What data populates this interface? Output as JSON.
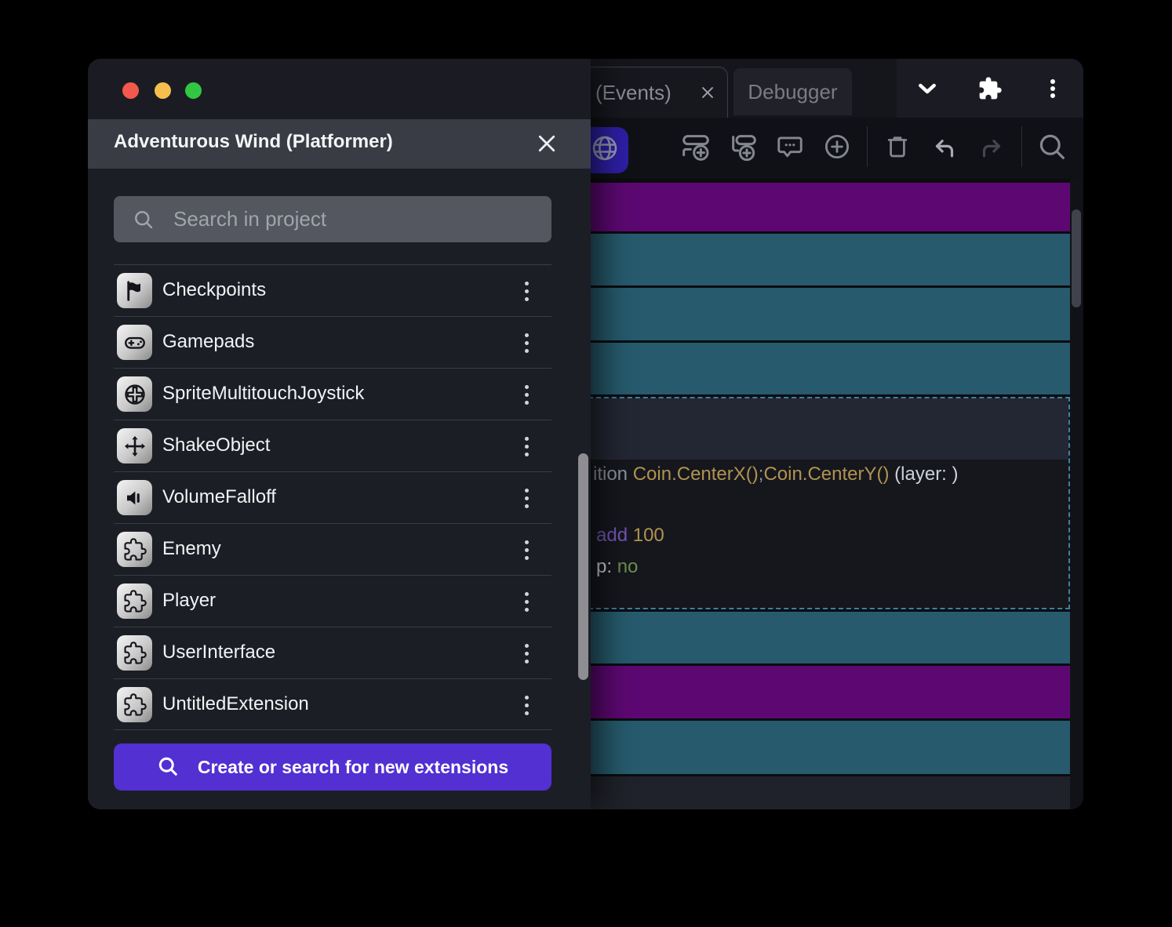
{
  "project_panel": {
    "title": "Adventurous Wind (Platformer)",
    "search_placeholder": "Search in project",
    "items": [
      {
        "label": "Checkpoints",
        "icon": "flag"
      },
      {
        "label": "Gamepads",
        "icon": "gamepad"
      },
      {
        "label": "SpriteMultitouchJoystick",
        "icon": "joystick"
      },
      {
        "label": "ShakeObject",
        "icon": "move"
      },
      {
        "label": "VolumeFalloff",
        "icon": "volume"
      },
      {
        "label": "Enemy",
        "icon": "puzzle"
      },
      {
        "label": "Player",
        "icon": "puzzle"
      },
      {
        "label": "UserInterface",
        "icon": "puzzle"
      },
      {
        "label": "UntitledExtension",
        "icon": "puzzle"
      }
    ],
    "cta_label": "Create or search for new extensions"
  },
  "editor": {
    "tabs": [
      {
        "label": "(Events)",
        "active": true,
        "closable": true
      },
      {
        "label": "Debugger",
        "active": false
      }
    ],
    "window_icons": [
      "chevron-down",
      "puzzle-filled",
      "kebab"
    ],
    "toolbar": [
      {
        "icon": "add-event"
      },
      {
        "icon": "add-subevent"
      },
      {
        "icon": "comment"
      },
      {
        "icon": "add-circle"
      },
      {
        "divider": true
      },
      {
        "icon": "trash"
      },
      {
        "icon": "undo"
      },
      {
        "icon": "redo",
        "disabled": true
      },
      {
        "divider": true
      },
      {
        "icon": "search"
      }
    ],
    "rows": [
      "purple",
      "teal",
      "teal",
      "teal",
      "selected",
      "teal",
      "purple",
      "teal"
    ],
    "code_lines": [
      {
        "segments": [
          {
            "text": "ition ",
            "tone": "muted"
          },
          {
            "text": "Coin.CenterX()",
            "tone": "gold"
          },
          {
            "text": ";",
            "tone": "muted"
          },
          {
            "text": "Coin.CenterY()",
            "tone": "gold"
          },
          {
            "text": " (layer: )",
            "tone": "light"
          }
        ]
      },
      {
        "segments": [
          {
            "text": "add ",
            "tone": "keyword"
          },
          {
            "text": "100",
            "tone": "gold"
          }
        ]
      },
      {
        "segments": [
          {
            "text": "p: ",
            "tone": "light"
          },
          {
            "text": "no",
            "tone": "green"
          }
        ]
      }
    ],
    "colors": {
      "event_purple": "#5D0872",
      "event_teal": "#265A6C",
      "selection_border": "#3F7FA0",
      "cta_purple": "#5230D2",
      "toolbar_accent": "#2E1FA6"
    }
  }
}
